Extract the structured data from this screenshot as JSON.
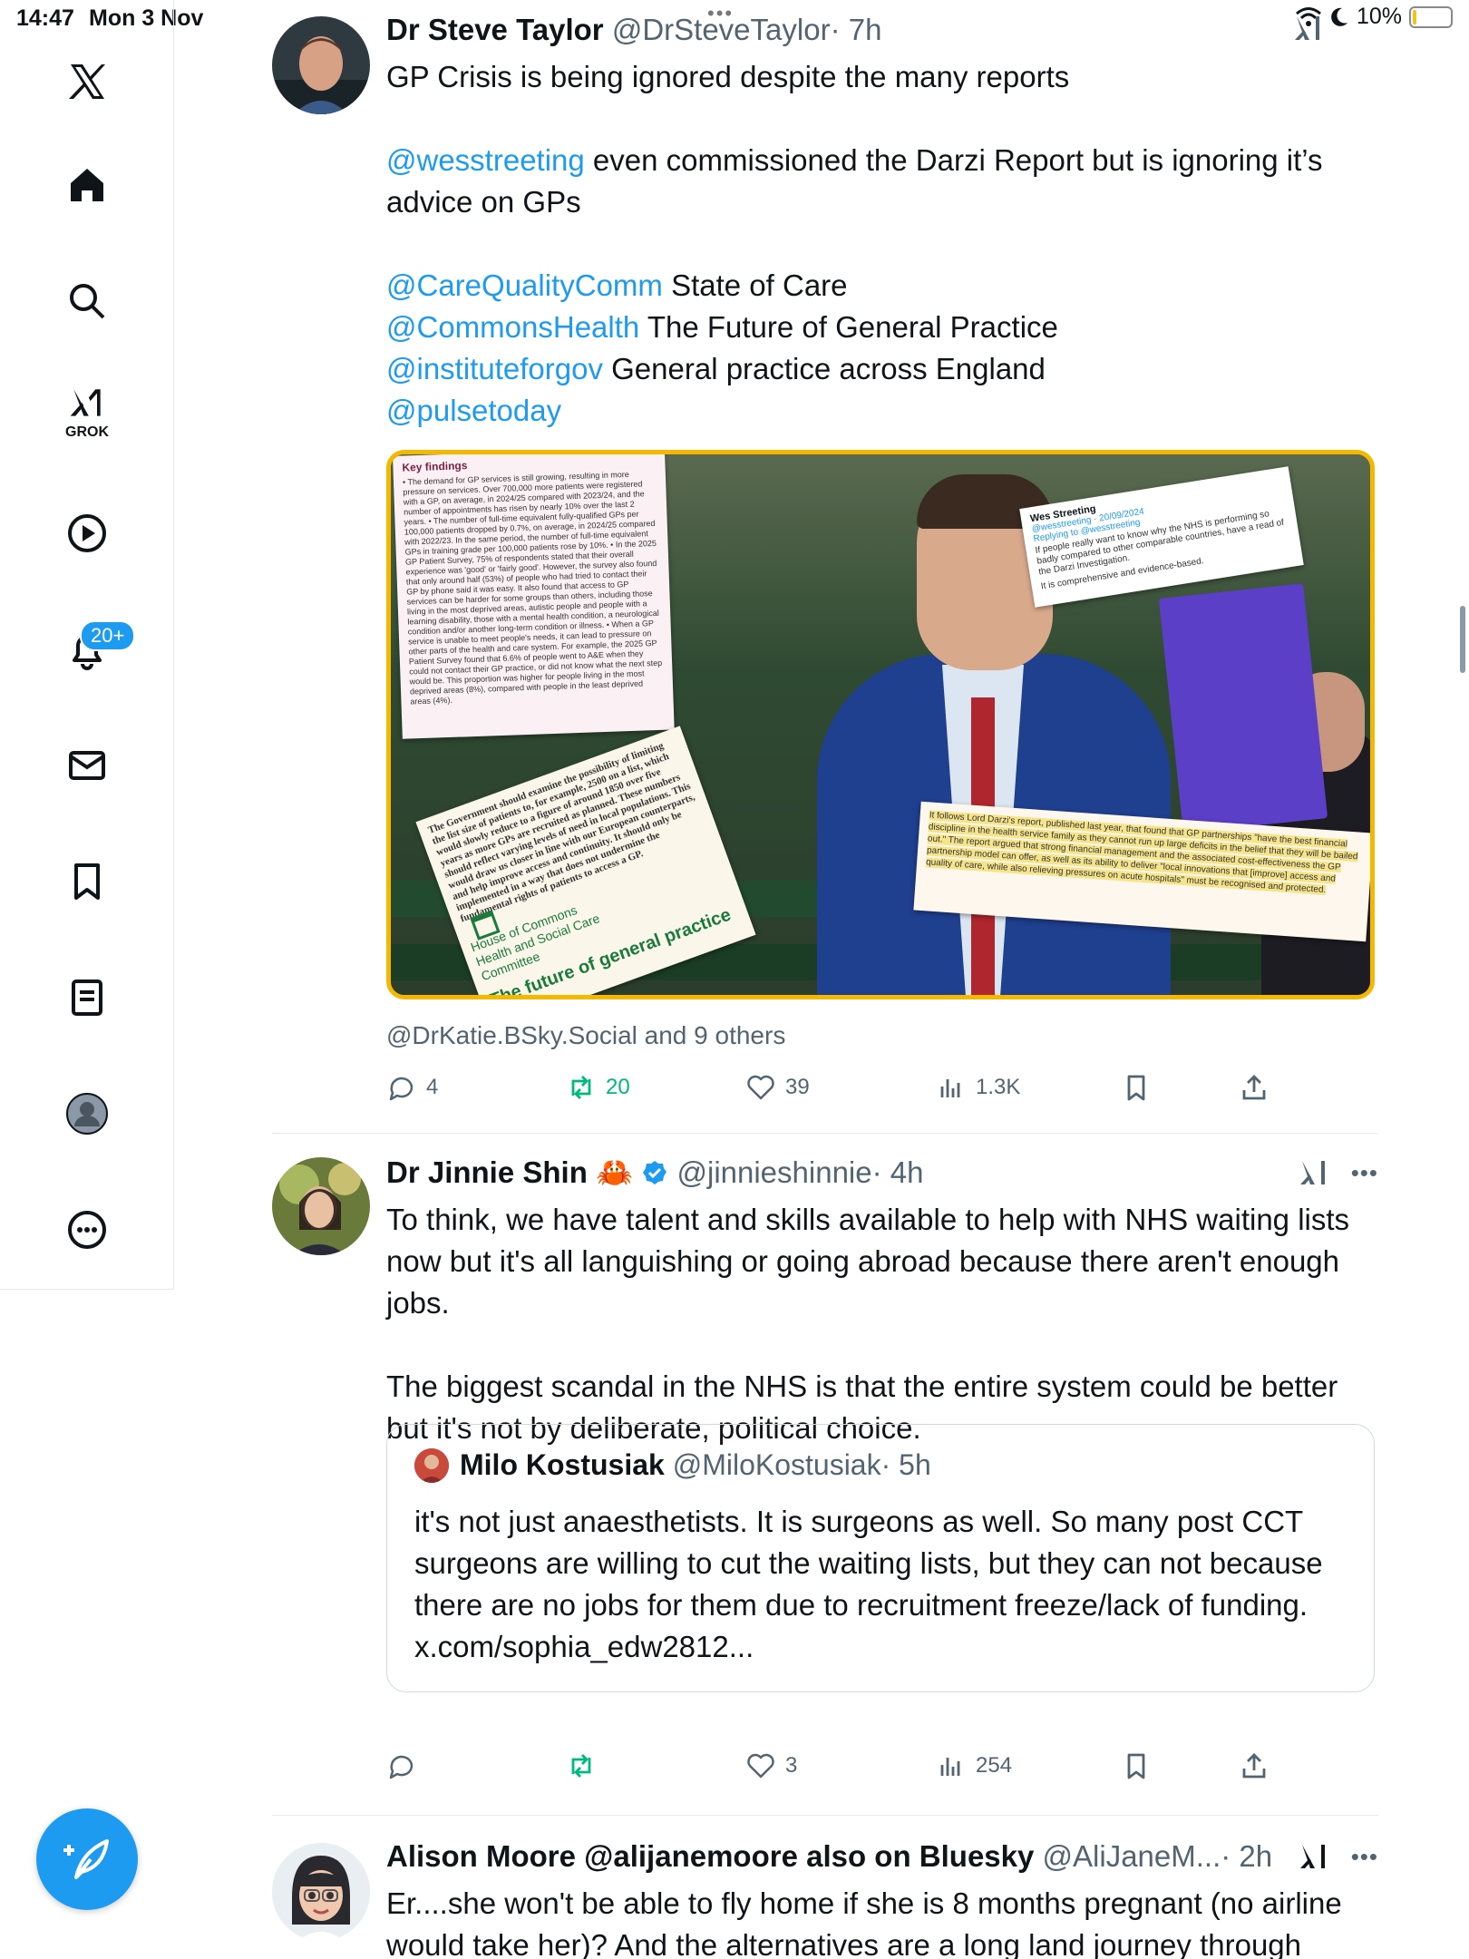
{
  "status_bar": {
    "time": "14:47",
    "date": "Mon 3 Nov",
    "battery": "10%",
    "battery_level": 0.1
  },
  "sidebar": {
    "items": [
      {
        "icon": "x-logo-icon"
      },
      {
        "icon": "home-icon"
      },
      {
        "icon": "search-icon"
      },
      {
        "icon": "grok-icon",
        "label": "GROK"
      },
      {
        "icon": "play-icon"
      },
      {
        "icon": "bell-icon",
        "badge": "20+"
      },
      {
        "icon": "mail-icon"
      },
      {
        "icon": "bookmark-icon"
      },
      {
        "icon": "list-icon"
      },
      {
        "icon": "profile-icon"
      },
      {
        "icon": "more-icon"
      }
    ],
    "compose_icon": "compose-icon"
  },
  "tweets": [
    {
      "name": "Dr Steve Taylor",
      "handle": "@DrSteveTaylor",
      "time": "· 7h",
      "line1": "GP Crisis is being ignored despite the many reports",
      "p2_mention": "@wesstreeting",
      "p2_text": " even commissioned the Darzi Report but is ignoring it’s advice on GPs",
      "refs": [
        {
          "mention": "@CareQualityComm",
          "text": " State of Care"
        },
        {
          "mention": "@CommonsHealth",
          "text": " The Future of General Practice"
        },
        {
          "mention": "@instituteforgov",
          "text": " General practice across England"
        },
        {
          "mention": "@pulsetoday",
          "text": ""
        }
      ],
      "media": {
        "findings_title": "Key findings",
        "findings_text": "• The demand for GP services is still growing, resulting in more pressure on services. Over 700,000 more patients were registered with a GP, on average, in 2024/25 compared with 2023/24, and the number of appointments has risen by nearly 10% over the last 2 years. • The number of full-time equivalent fully-qualified GPs per 100,000 patients dropped by 0.7%, on average, in 2024/25 compared with 2022/23. In the same period, the number of full-time equivalent GPs in training grade per 100,000 patients rose by 10%. • In the 2025 GP Patient Survey, 75% of respondents stated that their overall experience was 'good' or 'fairly good'. However, the survey also found that only around half (53%) of people who had tried to contact their GP by phone said it was easy. It also found that access to GP services can be harder for some groups than others, including those living in the most deprived areas, autistic people and people with a learning disability, those with a mental health condition, a neurological condition and/or another long-term condition or illness. • When a GP service is unable to meet people's needs, it can lead to pressure on other parts of the health and care system. For example, the 2025 GP Patient Survey found that 6.6% of people went to A&E when they could not contact their GP practice, or did not know what the next step would be. This proportion was higher for people living in the most deprived areas (8%), compared with people in the least deprived areas (4%).",
        "quote_name": "Wes Streeting",
        "quote_handle": "@wesstreeting · 20/09/2024",
        "quote_reply": "Replying to @wesstreeting",
        "quote_text": "If people really want to know why the NHS is performing so badly compared to other comparable countries, have a read of the Darzi Investigation.",
        "quote_text2": "It is comprehensive and evidence-based.",
        "darzi_text": "It follows Lord Darzi's report, published last year, that found that GP partnerships \"have the best financial discipline in the health service family as they cannot run up large deficits in the belief that they will be bailed out.\" The report argued that strong financial management and the associated cost-effectiveness the GP partnership model can offer, as well as its ability to deliver \"local innovations that [improve] access and quality of care, while also relieving pressures on acute hospitals\" must be recognised and protected.",
        "gov_text": "The Government should examine the possibility of limiting the list size of patients to, for example, 2500 on a list, which would slowly reduce to a figure of around 1850 over five years as more GPs are recruited as planned. These numbers should reflect varying levels of need in local populations. This would draw us closer in line with our European counterparts, and help improve access and continuity. It should only be implemented in a way that does not undermine the fundamental rights of patients to access a GP.",
        "hoc_line1": "House of Commons",
        "hoc_line2": "Health and Social Care",
        "hoc_line3": "Committee",
        "hoc_title": "The future of general practice"
      },
      "tagged": "@DrKatie.BSky.Social and 9 others",
      "actions": {
        "replies": "4",
        "reposts": "20",
        "likes": "39",
        "views": "1.3K"
      }
    },
    {
      "name": "Dr Jinnie Shin",
      "emoji": "🦀",
      "handle": "@jinnieshinnie",
      "time": "· 4h",
      "p1": "To think, we have talent and skills available to help with NHS waiting lists now but it's all languishing or going abroad because there aren't enough jobs.",
      "p2": "The biggest scandal in the NHS is that the entire system could be better but it's not by deliberate, political choice.",
      "quoted": {
        "name": "Milo Kostusiak",
        "handle": "@MiloKostusiak",
        "time": "· 5h",
        "text": "it's not just anaesthetists. It is surgeons as well. So many post CCT surgeons are willing to cut the waiting lists, but they can not because there are no jobs for them due to recruitment freeze/lack of funding. x.com/sophia_edw2812..."
      },
      "actions": {
        "replies": "",
        "reposts": "",
        "likes": "3",
        "views": "254"
      }
    },
    {
      "name": "Alison Moore @alijanemoore also on Bluesky",
      "handle": "@AliJaneM...",
      "time": "· 2h",
      "text": "Er....she won't be able to fly home if she is 8 months pregnant (no airline would take her)? And the alternatives are a long land journey through"
    }
  ],
  "colors": {
    "accent": "#1d9bf0",
    "repost_green": "#00ba7c",
    "secondary_text": "#536471",
    "media_border": "#f5b800"
  }
}
